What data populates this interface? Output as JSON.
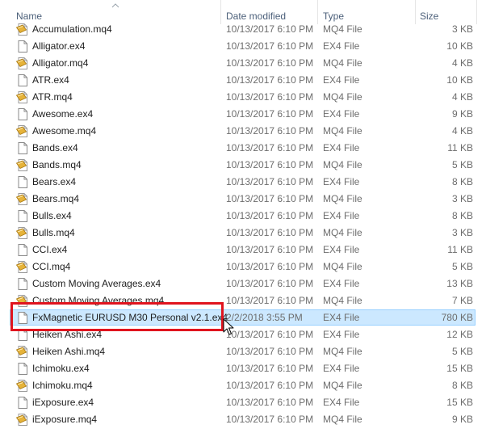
{
  "columns": {
    "name": "Name",
    "date": "Date modified",
    "type": "Type",
    "size": "Size"
  },
  "files": [
    {
      "name": "Accumulation.mq4",
      "date": "10/13/2017 6:10 PM",
      "type": "MQ4 File",
      "size": "3 KB",
      "icon": "mq4-file-icon"
    },
    {
      "name": "Alligator.ex4",
      "date": "10/13/2017 6:10 PM",
      "type": "EX4 File",
      "size": "10 KB",
      "icon": "blank-file-icon"
    },
    {
      "name": "Alligator.mq4",
      "date": "10/13/2017 6:10 PM",
      "type": "MQ4 File",
      "size": "4 KB",
      "icon": "mq4-file-icon"
    },
    {
      "name": "ATR.ex4",
      "date": "10/13/2017 6:10 PM",
      "type": "EX4 File",
      "size": "10 KB",
      "icon": "blank-file-icon"
    },
    {
      "name": "ATR.mq4",
      "date": "10/13/2017 6:10 PM",
      "type": "MQ4 File",
      "size": "4 KB",
      "icon": "mq4-file-icon"
    },
    {
      "name": "Awesome.ex4",
      "date": "10/13/2017 6:10 PM",
      "type": "EX4 File",
      "size": "9 KB",
      "icon": "blank-file-icon"
    },
    {
      "name": "Awesome.mq4",
      "date": "10/13/2017 6:10 PM",
      "type": "MQ4 File",
      "size": "4 KB",
      "icon": "mq4-file-icon"
    },
    {
      "name": "Bands.ex4",
      "date": "10/13/2017 6:10 PM",
      "type": "EX4 File",
      "size": "11 KB",
      "icon": "blank-file-icon"
    },
    {
      "name": "Bands.mq4",
      "date": "10/13/2017 6:10 PM",
      "type": "MQ4 File",
      "size": "5 KB",
      "icon": "mq4-file-icon"
    },
    {
      "name": "Bears.ex4",
      "date": "10/13/2017 6:10 PM",
      "type": "EX4 File",
      "size": "8 KB",
      "icon": "blank-file-icon"
    },
    {
      "name": "Bears.mq4",
      "date": "10/13/2017 6:10 PM",
      "type": "MQ4 File",
      "size": "3 KB",
      "icon": "mq4-file-icon"
    },
    {
      "name": "Bulls.ex4",
      "date": "10/13/2017 6:10 PM",
      "type": "EX4 File",
      "size": "8 KB",
      "icon": "blank-file-icon"
    },
    {
      "name": "Bulls.mq4",
      "date": "10/13/2017 6:10 PM",
      "type": "MQ4 File",
      "size": "3 KB",
      "icon": "mq4-file-icon"
    },
    {
      "name": "CCI.ex4",
      "date": "10/13/2017 6:10 PM",
      "type": "EX4 File",
      "size": "11 KB",
      "icon": "blank-file-icon"
    },
    {
      "name": "CCI.mq4",
      "date": "10/13/2017 6:10 PM",
      "type": "MQ4 File",
      "size": "5 KB",
      "icon": "mq4-file-icon"
    },
    {
      "name": "Custom Moving Averages.ex4",
      "date": "10/13/2017 6:10 PM",
      "type": "EX4 File",
      "size": "13 KB",
      "icon": "blank-file-icon"
    },
    {
      "name": "Custom Moving Averages.mq4",
      "date": "10/13/2017 6:10 PM",
      "type": "MQ4 File",
      "size": "7 KB",
      "icon": "mq4-file-icon"
    },
    {
      "name": "FxMagnetic EURUSD M30 Personal v2.1.ex4",
      "date": "2/2/2018 3:55 PM",
      "type": "EX4 File",
      "size": "780 KB",
      "icon": "blank-file-icon",
      "selected": true
    },
    {
      "name": "Heiken Ashi.ex4",
      "date": "10/13/2017 6:10 PM",
      "type": "EX4 File",
      "size": "12 KB",
      "icon": "blank-file-icon"
    },
    {
      "name": "Heiken Ashi.mq4",
      "date": "10/13/2017 6:10 PM",
      "type": "MQ4 File",
      "size": "5 KB",
      "icon": "mq4-file-icon"
    },
    {
      "name": "Ichimoku.ex4",
      "date": "10/13/2017 6:10 PM",
      "type": "EX4 File",
      "size": "15 KB",
      "icon": "blank-file-icon"
    },
    {
      "name": "Ichimoku.mq4",
      "date": "10/13/2017 6:10 PM",
      "type": "MQ4 File",
      "size": "8 KB",
      "icon": "mq4-file-icon"
    },
    {
      "name": "iExposure.ex4",
      "date": "10/13/2017 6:10 PM",
      "type": "EX4 File",
      "size": "15 KB",
      "icon": "blank-file-icon"
    },
    {
      "name": "iExposure.mq4",
      "date": "10/13/2017 6:10 PM",
      "type": "MQ4 File",
      "size": "9 KB",
      "icon": "mq4-file-icon"
    }
  ],
  "colors": {
    "selection_bg": "#cce8ff",
    "selection_border": "#99d1ff",
    "highlight_border": "#e0141e"
  }
}
